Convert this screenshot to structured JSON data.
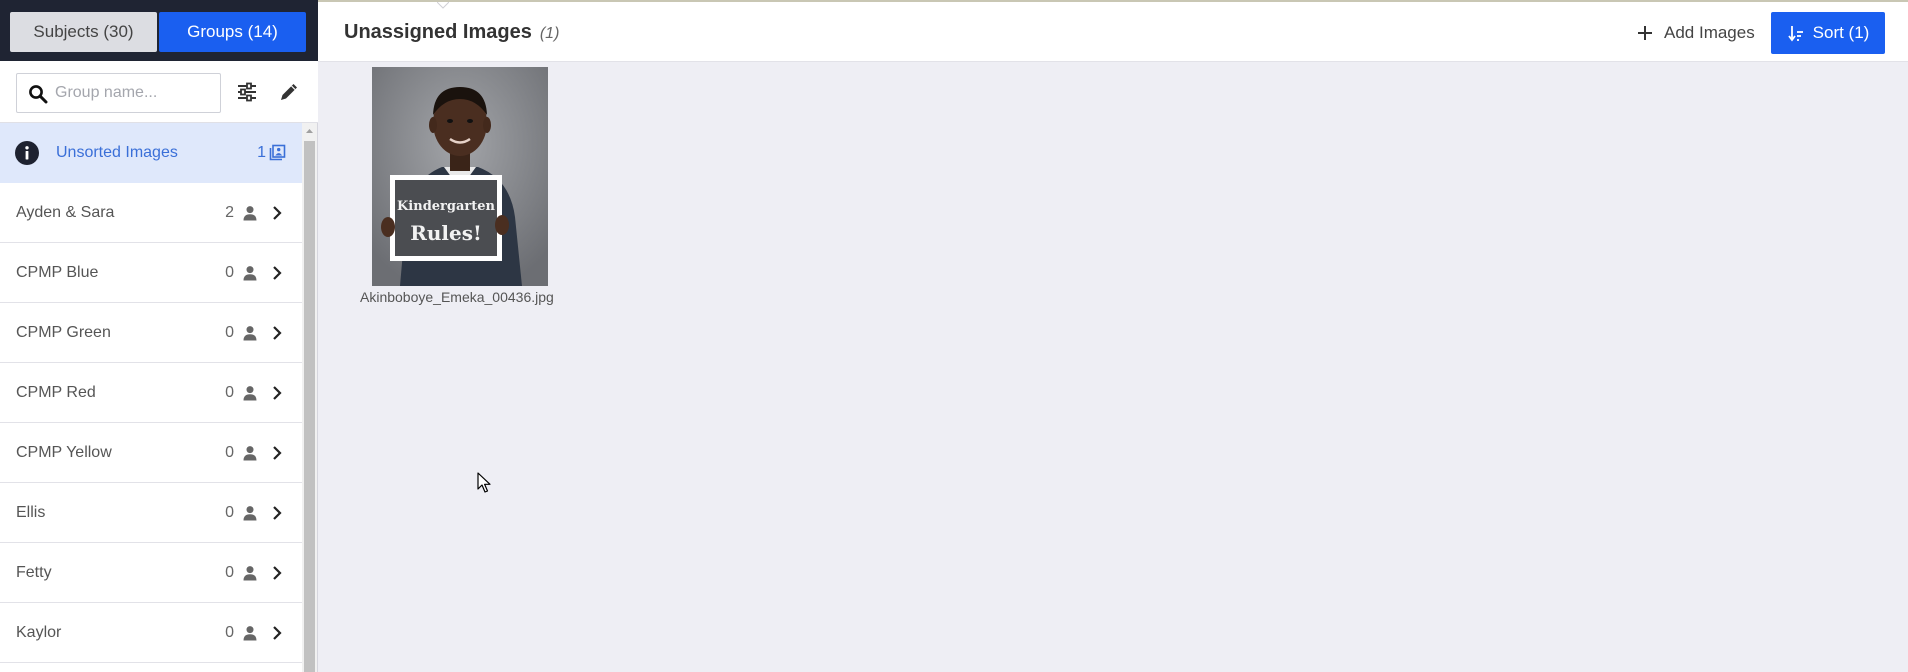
{
  "tabs": {
    "subjects": "Subjects (30)",
    "groups": "Groups (14)"
  },
  "search": {
    "placeholder": "Group name...",
    "value": ""
  },
  "groups": [
    {
      "name": "Unsorted Images",
      "count": "1",
      "active": true
    },
    {
      "name": "Ayden & Sara",
      "count": "2"
    },
    {
      "name": "CPMP Blue",
      "count": "0"
    },
    {
      "name": "CPMP Green",
      "count": "0"
    },
    {
      "name": "CPMP Red",
      "count": "0"
    },
    {
      "name": "CPMP Yellow",
      "count": "0"
    },
    {
      "name": "Ellis",
      "count": "0"
    },
    {
      "name": "Fetty",
      "count": "0"
    },
    {
      "name": "Kaylor",
      "count": "0"
    }
  ],
  "header": {
    "title": "Unassigned Images",
    "count": "(1)",
    "add_images_label": "Add Images",
    "sort_label": "Sort (1)"
  },
  "images": [
    {
      "filename": "Akinboboye_Emeka_00436.jpg",
      "sign_line1": "Kindergarten",
      "sign_line2": "Rules!"
    }
  ],
  "colors": {
    "accent": "#1a5ff0",
    "sidebar_dark": "#1f2433",
    "active_row_bg": "#dfe8fb",
    "active_text": "#3a6fd8",
    "canvas_bg": "#eeeef4"
  },
  "icons": {
    "search": "search-icon",
    "filter": "sliders-icon",
    "edit": "pencil-icon",
    "info": "info-icon",
    "person": "person-icon",
    "images": "images-icon",
    "chevron": "chevron-right-icon",
    "add": "plus-icon",
    "sort": "sort-icon"
  }
}
